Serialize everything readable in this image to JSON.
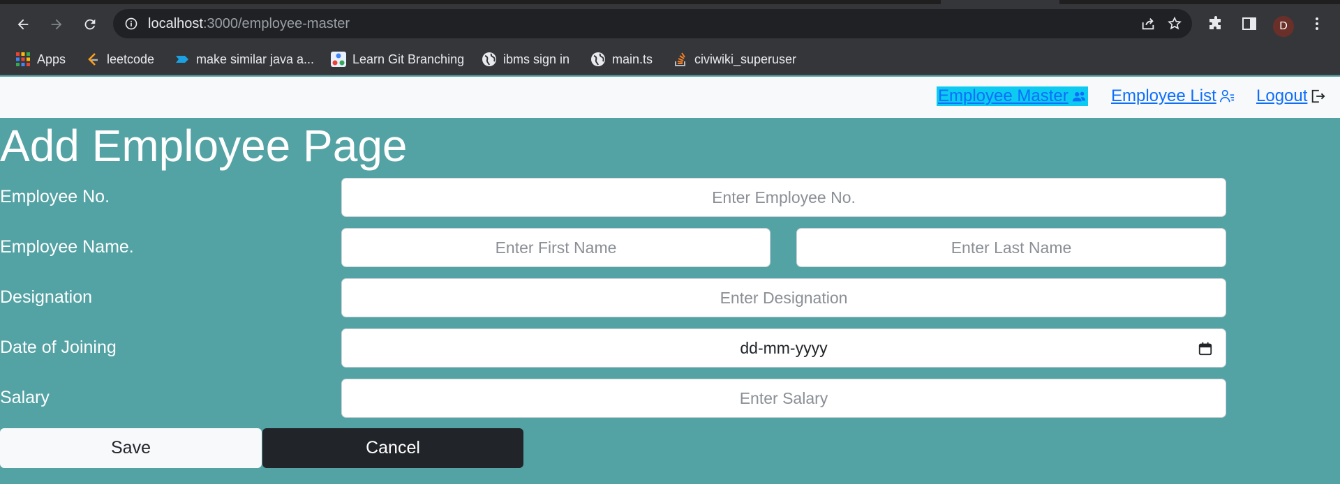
{
  "browser": {
    "url_host": "localhost",
    "url_rest": ":3000/employee-master",
    "profile_initial": "D",
    "bookmarks": [
      {
        "label": "Apps",
        "icon": "apps-grid-icon"
      },
      {
        "label": "leetcode",
        "icon": "leetcode-icon"
      },
      {
        "label": "make similar java a...",
        "icon": "bookmark-tag-icon"
      },
      {
        "label": "Learn Git Branching",
        "icon": "git-branching-icon"
      },
      {
        "label": "ibms sign in",
        "icon": "globe-icon"
      },
      {
        "label": "main.ts",
        "icon": "globe-icon"
      },
      {
        "label": "civiwiki_superuser",
        "icon": "stackoverflow-icon"
      }
    ]
  },
  "navbar": {
    "links": [
      {
        "label": "Employee Master",
        "icon": "users-icon",
        "active": true
      },
      {
        "label": "Employee List",
        "icon": "user-list-icon",
        "active": false
      },
      {
        "label": "Logout",
        "icon": "logout-icon",
        "active": false
      }
    ]
  },
  "form": {
    "title": "Add Employee Page",
    "employee_no": {
      "label": "Employee No.",
      "placeholder": "Enter Employee No.",
      "value": ""
    },
    "employee_name": {
      "label": "Employee Name.",
      "first_placeholder": "Enter First Name",
      "last_placeholder": "Enter Last Name"
    },
    "designation": {
      "label": "Designation",
      "placeholder": "Enter Designation",
      "value": ""
    },
    "date_of_joining": {
      "label": "Date of Joining",
      "placeholder": "dd-mm-yyyy"
    },
    "salary": {
      "label": "Salary",
      "placeholder": "Enter Salary",
      "value": ""
    },
    "save_label": "Save",
    "cancel_label": "Cancel"
  },
  "colors": {
    "page_background": "#53a2a4",
    "navbar_background": "#f8f9fa",
    "active_link_highlight": "#0dcaf0",
    "link_color": "#0d6efd",
    "cancel_button": "#212529"
  }
}
